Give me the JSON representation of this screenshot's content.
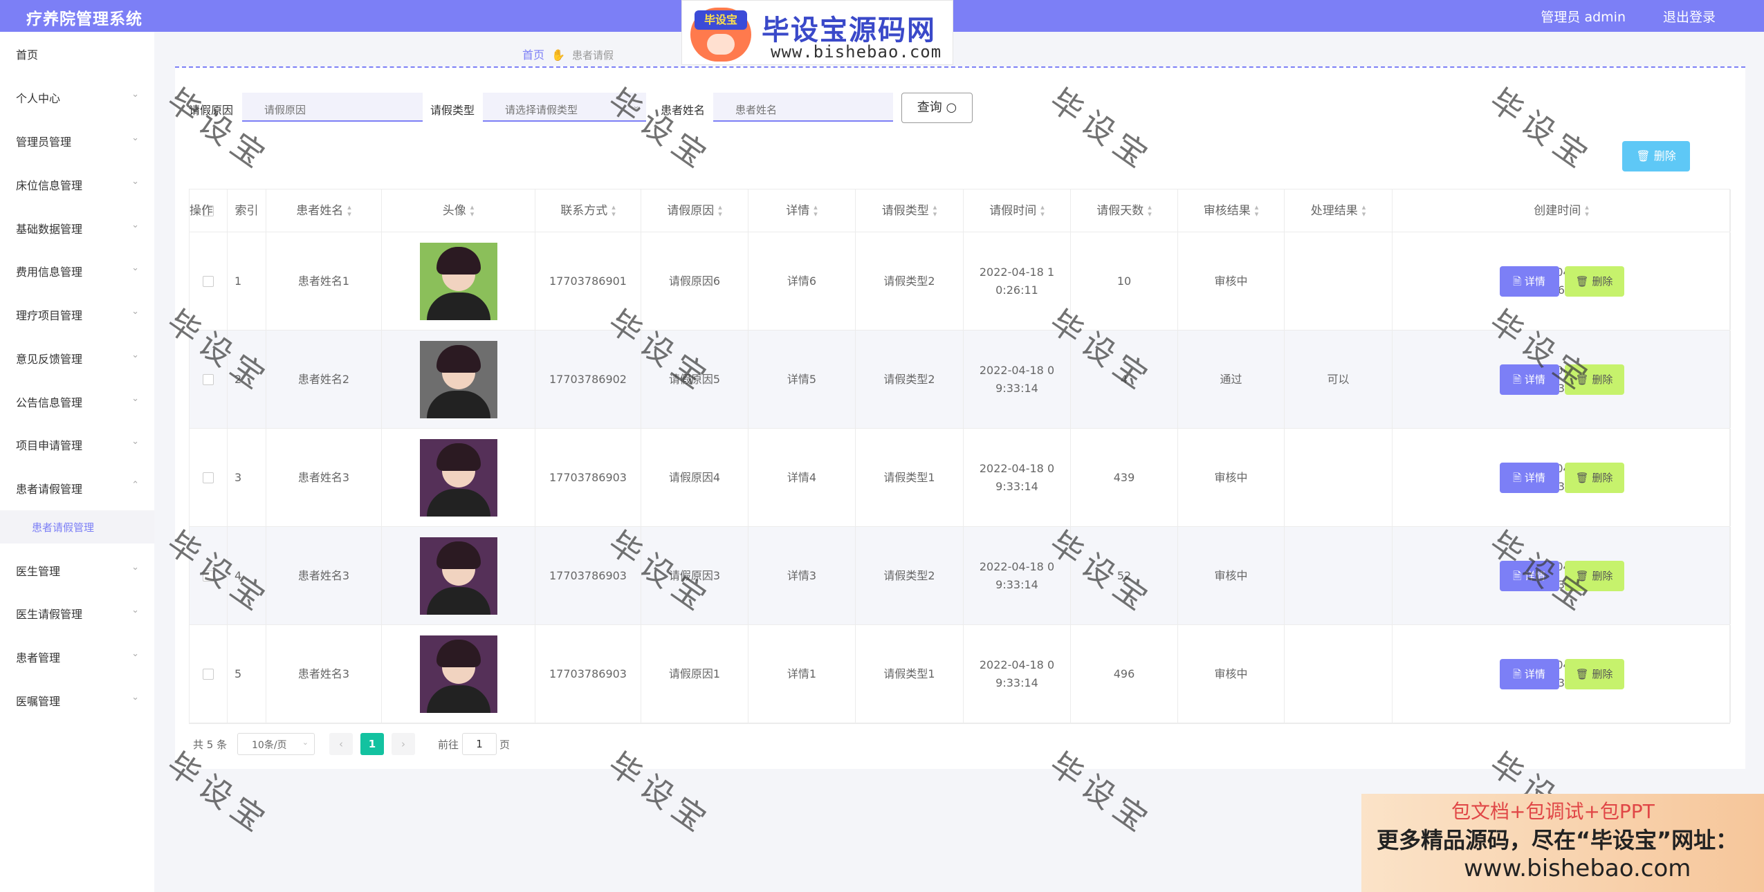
{
  "header": {
    "app_title": "疗养院管理系统",
    "user": "管理员 admin",
    "logout": "退出登录"
  },
  "watermark_banner": {
    "logo_tag": "毕设宝",
    "site_name": "毕设宝源码网",
    "site_url": "www.bishebao.com"
  },
  "sidebar": {
    "items": [
      {
        "label": "首页",
        "has_arrow": false
      },
      {
        "label": "个人中心",
        "has_arrow": true
      },
      {
        "label": "管理员管理",
        "has_arrow": true
      },
      {
        "label": "床位信息管理",
        "has_arrow": true
      },
      {
        "label": "基础数据管理",
        "has_arrow": true
      },
      {
        "label": "费用信息管理",
        "has_arrow": true
      },
      {
        "label": "理疗项目管理",
        "has_arrow": true
      },
      {
        "label": "意见反馈管理",
        "has_arrow": true
      },
      {
        "label": "公告信息管理",
        "has_arrow": true
      },
      {
        "label": "项目申请管理",
        "has_arrow": true
      },
      {
        "label": "患者请假管理",
        "has_arrow": true,
        "expanded": true
      },
      {
        "label": "医生管理",
        "has_arrow": true
      },
      {
        "label": "医生请假管理",
        "has_arrow": true
      },
      {
        "label": "患者管理",
        "has_arrow": true
      },
      {
        "label": "医嘱管理",
        "has_arrow": true
      }
    ],
    "active_sub": "患者请假管理"
  },
  "breadcrumb": {
    "home": "首页",
    "current": "患者请假"
  },
  "filters": {
    "reason_label": "请假原因",
    "reason_placeholder": "请假原因",
    "type_label": "请假类型",
    "type_placeholder": "请选择请假类型",
    "name_label": "患者姓名",
    "name_placeholder": "患者姓名",
    "query_button": "查询 ○"
  },
  "toolbar": {
    "batch_delete": "🗑 删除"
  },
  "table": {
    "columns": [
      "索引",
      "患者姓名",
      "头像",
      "联系方式",
      "请假原因",
      "详情",
      "请假类型",
      "请假时间",
      "请假天数",
      "审核结果",
      "处理结果",
      "创建时间",
      "操作"
    ],
    "rows": [
      {
        "index": "1",
        "name": "患者姓名1",
        "avatar": "green",
        "phone": "17703786901",
        "reason": "请假原因6",
        "detail": "详情6",
        "type": "请假类型2",
        "leave_time": "2022-04-18 10:26:11",
        "days": "10",
        "audit": "审核中",
        "handle": "",
        "created": "2022-04-18 10:26:15"
      },
      {
        "index": "2",
        "name": "患者姓名2",
        "avatar": "gray",
        "phone": "17703786902",
        "reason": "请假原因5",
        "detail": "详情5",
        "type": "请假类型2",
        "leave_time": "2022-04-18 09:33:14",
        "days": "4",
        "audit": "通过",
        "handle": "可以",
        "created": "2022-04-18 09:33:14"
      },
      {
        "index": "3",
        "name": "患者姓名3",
        "avatar": "dark",
        "phone": "17703786903",
        "reason": "请假原因4",
        "detail": "详情4",
        "type": "请假类型1",
        "leave_time": "2022-04-18 09:33:14",
        "days": "439",
        "audit": "审核中",
        "handle": "",
        "created": "2022-04-18 09:33:14"
      },
      {
        "index": "4",
        "name": "患者姓名3",
        "avatar": "dark",
        "phone": "17703786903",
        "reason": "请假原因3",
        "detail": "详情3",
        "type": "请假类型2",
        "leave_time": "2022-04-18 09:33:14",
        "days": "52",
        "audit": "审核中",
        "handle": "",
        "created": "2022-04-18 09:33:14"
      },
      {
        "index": "5",
        "name": "患者姓名3",
        "avatar": "dark",
        "phone": "17703786903",
        "reason": "请假原因1",
        "detail": "详情1",
        "type": "请假类型1",
        "leave_time": "2022-04-18 09:33:14",
        "days": "496",
        "audit": "审核中",
        "handle": "",
        "created": "2022-04-18 09:33:14"
      }
    ],
    "detail_button": "🗎 详情",
    "delete_button": "🗑 删除"
  },
  "pagination": {
    "total": "共 5 条",
    "page_size": "10条/页",
    "current_page": "1",
    "goto_label": "前往",
    "goto_value": "1",
    "page_suffix": "页"
  },
  "watermark_text": "毕设宝",
  "ad": {
    "line1": "包文档+包调试+包PPT",
    "line2": "更多精品源码，尽在“毕设宝”网址：",
    "line3": "www.bishebao.com"
  },
  "colors": {
    "primary": "#7c7ff6",
    "header_bg": "#7c7ff6",
    "delete_btn": "#c6f26c",
    "batch_delete": "#5ec8f6",
    "active_page": "#13c2a0"
  }
}
